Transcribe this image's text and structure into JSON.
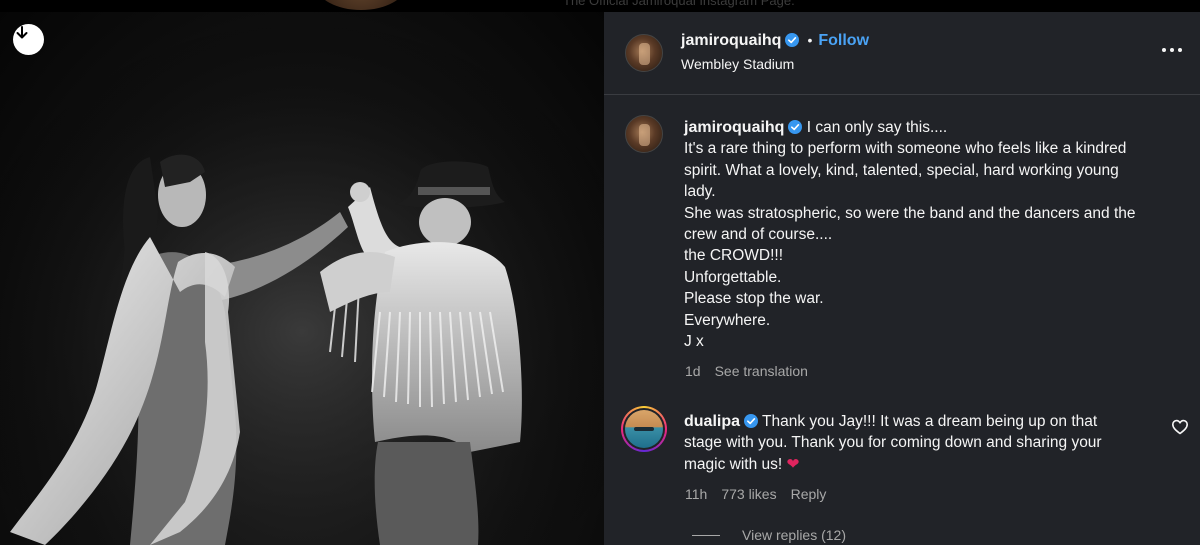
{
  "background": {
    "bio_text": "The Official Jamiroquai Instagram Page."
  },
  "post": {
    "author": "jamiroquaihq",
    "follow_label": "Follow",
    "separator": "•",
    "location": "Wembley Stadium",
    "caption_lines": [
      "I can only say this....",
      "It's a rare thing to perform with someone who feels like a kindred",
      "spirit. What a lovely, kind, talented, special, hard working young",
      "lady.",
      "She was stratospheric, so were the band and the dancers and the",
      "crew and of course....",
      "the CROWD!!!",
      "Unforgettable.",
      "Please stop the war.",
      "Everywhere.",
      "J x"
    ],
    "caption_meta": {
      "time": "1d",
      "see_translation": "See translation"
    }
  },
  "comment": {
    "author": "dualipa",
    "lines": [
      "Thank you Jay!!! It was a dream being up on that",
      "stage with you. Thank you for coming down and sharing your",
      "magic with us!"
    ],
    "emoji": "❤",
    "meta": {
      "time": "11h",
      "likes": "773 likes",
      "reply": "Reply"
    },
    "view_replies": "View replies (12)"
  },
  "icons": {
    "download": "download-icon",
    "verified": "verified-badge-icon",
    "more": "more-options-icon",
    "like": "heart-icon"
  },
  "colors": {
    "panel": "#212328",
    "link": "#4aa3f5",
    "verified": "#3797f0",
    "muted": "#a8a8a8",
    "heart": "#e0245e"
  }
}
